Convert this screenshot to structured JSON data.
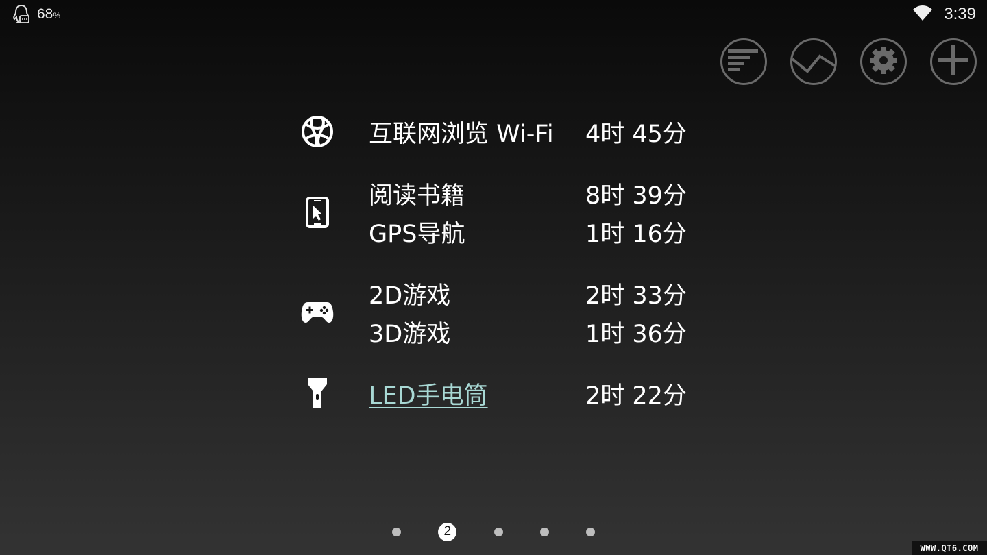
{
  "status_bar": {
    "notification_icon": "qq-penguin-icon",
    "battery_percent": "68",
    "battery_unit": "%",
    "wifi_icon": "wifi-icon",
    "time": "3:39"
  },
  "toolbar": {
    "buttons": [
      {
        "icon": "list-bars-icon"
      },
      {
        "icon": "trend-chart-icon"
      },
      {
        "icon": "gear-icon"
      },
      {
        "icon": "plus-icon"
      }
    ]
  },
  "usage": {
    "groups": [
      {
        "icon": "globe-icon",
        "items": [
          {
            "name": "互联网浏览 Wi-Fi",
            "time": "4时 45分"
          }
        ]
      },
      {
        "icon": "tablet-touch-icon",
        "items": [
          {
            "name": "阅读书籍",
            "time": "8时 39分"
          },
          {
            "name": "GPS导航",
            "time": "1时 16分"
          }
        ]
      },
      {
        "icon": "gamepad-icon",
        "items": [
          {
            "name": "2D游戏",
            "time": "2时 33分"
          },
          {
            "name": "3D游戏",
            "time": "1时 36分"
          }
        ]
      },
      {
        "icon": "flashlight-icon",
        "items": [
          {
            "name": "LED手电筒",
            "time": "2时 22分",
            "link": true
          }
        ]
      }
    ]
  },
  "pager": {
    "current": "2",
    "total_pages": 5
  },
  "watermark": "WWW.QT6.COM"
}
